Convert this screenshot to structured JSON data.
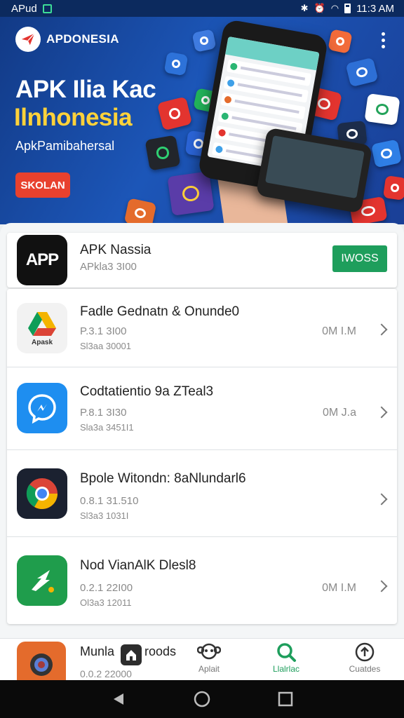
{
  "status_bar": {
    "left_text": "APud",
    "time": "11:3 AM"
  },
  "banner": {
    "brand": "APDONESIA",
    "title_line1": "APK Ilia Kac",
    "title_line2": "Ilnhonesia",
    "subtitle": "ApkPamibahersal",
    "cta_label": "SKOLAN"
  },
  "apps": [
    {
      "name": "APK Nassia",
      "meta1": "APkla3 3I00",
      "meta2": "",
      "size": "",
      "action": "IWOSS",
      "icon_text": "APP",
      "icon": "app-logo-icon"
    },
    {
      "name": "Fadle Gednatn & Onunde0",
      "meta1": "P.3.1 3I00",
      "meta2": "Sl3aa 30001",
      "size": "0M I.M",
      "icon_text": "Apask",
      "icon": "drive-icon"
    },
    {
      "name": "Codtatientio 9a ZTeal3",
      "meta1": "P.8.1 3I30",
      "meta2": "Sla3a 3451I1",
      "size": "0M J.a",
      "icon_text": "",
      "icon": "messenger-icon"
    },
    {
      "name": "Bpole Witondn: 8aNlundarl6",
      "meta1": "0.8.1 31.510",
      "meta2": "Sl3a3 1031I",
      "size": "",
      "icon_text": "",
      "icon": "chrome-icon"
    },
    {
      "name": "Nod VianAlK Dlesl8",
      "meta1": "0.2.1 22I00",
      "meta2": "Ol3a3 12011",
      "size": "0M I.M",
      "icon_text": "",
      "icon": "arrow-app-icon"
    }
  ],
  "partial_app": {
    "name": "Munla",
    "meta": "0.0.2 22000"
  },
  "bottom_nav": {
    "home_label": "roods",
    "tabs": [
      {
        "label": "Aplait",
        "icon": "monkey-icon"
      },
      {
        "label": "Llalrlac",
        "icon": "search-icon",
        "active": true
      },
      {
        "label": "Cuatdes",
        "icon": "upload-icon"
      }
    ]
  },
  "colors": {
    "accent": "#1e9e5c",
    "banner_bg": "#1c56b8",
    "cta": "#e8412e",
    "title_yellow": "#ffd23a"
  }
}
